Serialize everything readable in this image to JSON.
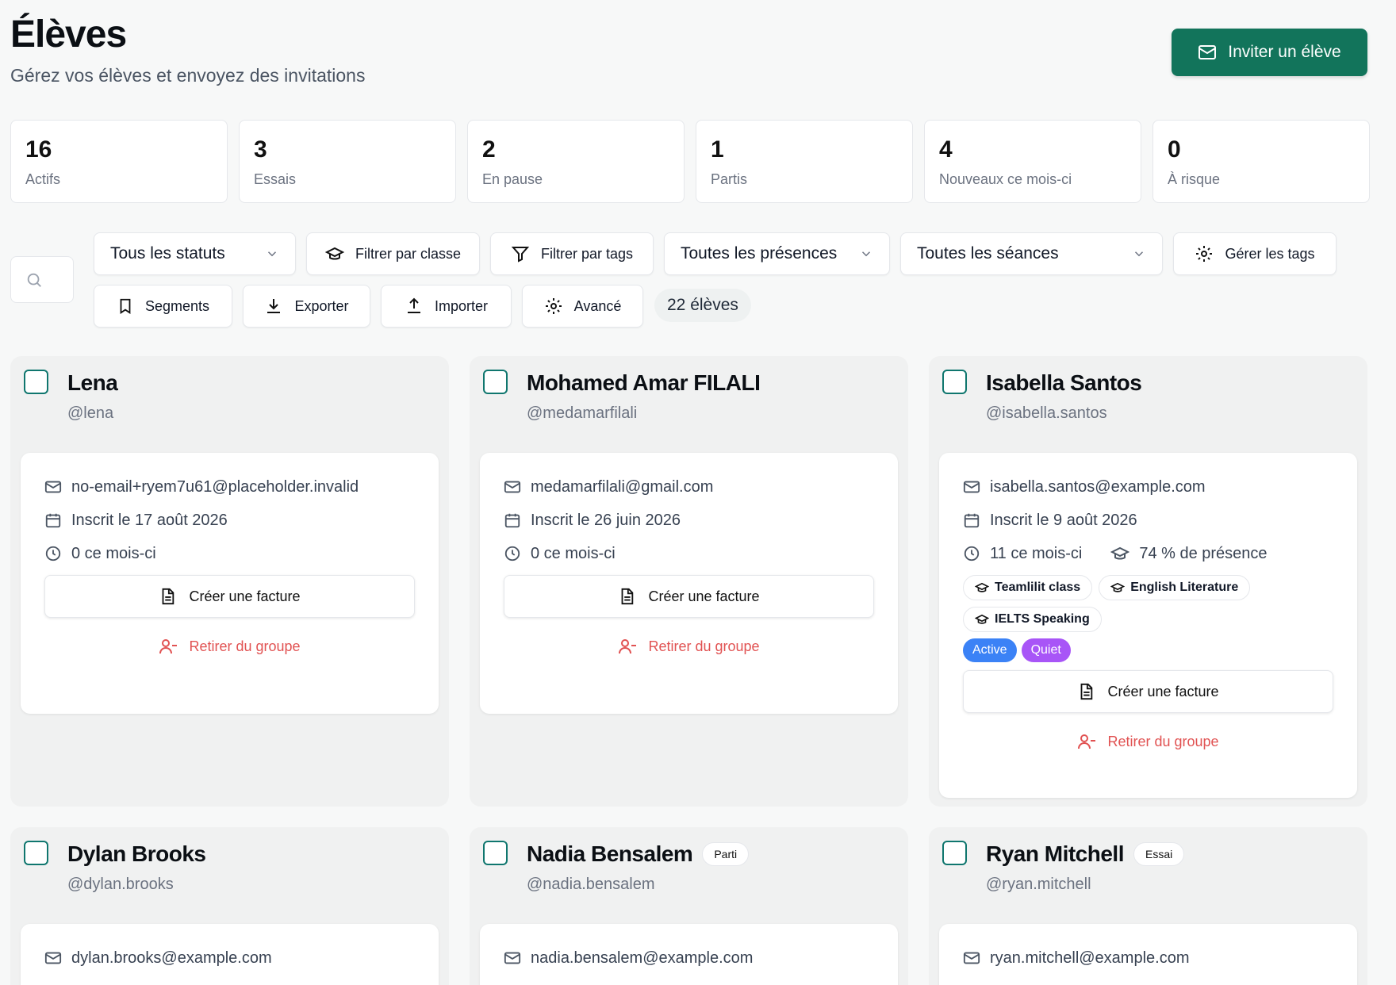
{
  "header": {
    "title": "Élèves",
    "subtitle": "Gérez vos élèves et envoyez des invitations",
    "invite_label": "Inviter un élève"
  },
  "stats": [
    {
      "value": "16",
      "label": "Actifs"
    },
    {
      "value": "3",
      "label": "Essais"
    },
    {
      "value": "2",
      "label": "En pause"
    },
    {
      "value": "1",
      "label": "Partis"
    },
    {
      "value": "4",
      "label": "Nouveaux ce mois-ci"
    },
    {
      "value": "0",
      "label": "À risque"
    }
  ],
  "filters": {
    "status_select": "Tous les statuts",
    "class_filter": "Filtrer par classe",
    "tags_filter": "Filtrer par tags",
    "presence_select": "Toutes les présences",
    "sessions_select": "Toutes les séances",
    "manage_tags": "Gérer les tags",
    "segments": "Segments",
    "export": "Exporter",
    "import": "Importer",
    "advanced": "Avancé",
    "count": "22 élèves"
  },
  "students": [
    {
      "name": "Lena",
      "handle": "@lena",
      "email": "no-email+ryem7u61@placeholder.invalid",
      "enrolled": "Inscrit le 17 août 2026",
      "month": "0 ce mois-ci",
      "invoice_label": "Créer une facture",
      "remove_label": "Retirer du groupe"
    },
    {
      "name": "Mohamed Amar FILALI",
      "handle": "@medamarfilali",
      "email": "medamarfilali@gmail.com",
      "enrolled": "Inscrit le 26 juin 2026",
      "month": "0 ce mois-ci",
      "invoice_label": "Créer une facture",
      "remove_label": "Retirer du groupe"
    },
    {
      "name": "Isabella Santos",
      "handle": "@isabella.santos",
      "email": "isabella.santos@example.com",
      "enrolled": "Inscrit le 9 août 2026",
      "month": "11 ce mois-ci",
      "presence": "74 % de présence",
      "classes": [
        "Teamlilit class",
        "English Literature",
        "IELTS Speaking"
      ],
      "tags": [
        {
          "label": "Active",
          "color": "#3b82f6"
        },
        {
          "label": "Quiet",
          "color": "#a855f7"
        }
      ],
      "invoice_label": "Créer une facture",
      "remove_label": "Retirer du groupe"
    },
    {
      "name": "Dylan Brooks",
      "handle": "@dylan.brooks",
      "email": "dylan.brooks@example.com"
    },
    {
      "name": "Nadia Bensalem",
      "badge": "Parti",
      "handle": "@nadia.bensalem",
      "email": "nadia.bensalem@example.com"
    },
    {
      "name": "Ryan Mitchell",
      "badge": "Essai",
      "handle": "@ryan.mitchell",
      "email": "ryan.mitchell@example.com"
    }
  ],
  "colors": {
    "brand": "#12745b",
    "danger": "#e15252",
    "tag_active": "#3b82f6",
    "tag_quiet": "#a855f7"
  }
}
